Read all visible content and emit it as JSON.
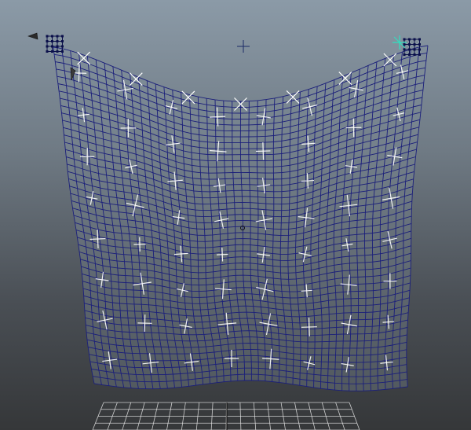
{
  "viewport": {
    "kind": "3d-viewport",
    "background_top": "#8b9aa7",
    "background_bottom": "#353739"
  },
  "cloth": {
    "mesh_color": "#1b1f7a",
    "fill_color": "#7f8b97",
    "locator_color": "#ffffff",
    "constraint_color": "#0a0f4a",
    "selected_locator_color": "#2fe0c0",
    "grid_columns": 44,
    "grid_rows": 46,
    "locator_columns": 8,
    "locator_rows": 8
  },
  "ground": {
    "grid_color": "#e8e8e8",
    "grid_columns": 18,
    "grid_rows": 4
  },
  "icons": {
    "pivot": "crosshair-plus",
    "left_handle": "cone-manipulator",
    "right_handle": "selected-locator"
  }
}
